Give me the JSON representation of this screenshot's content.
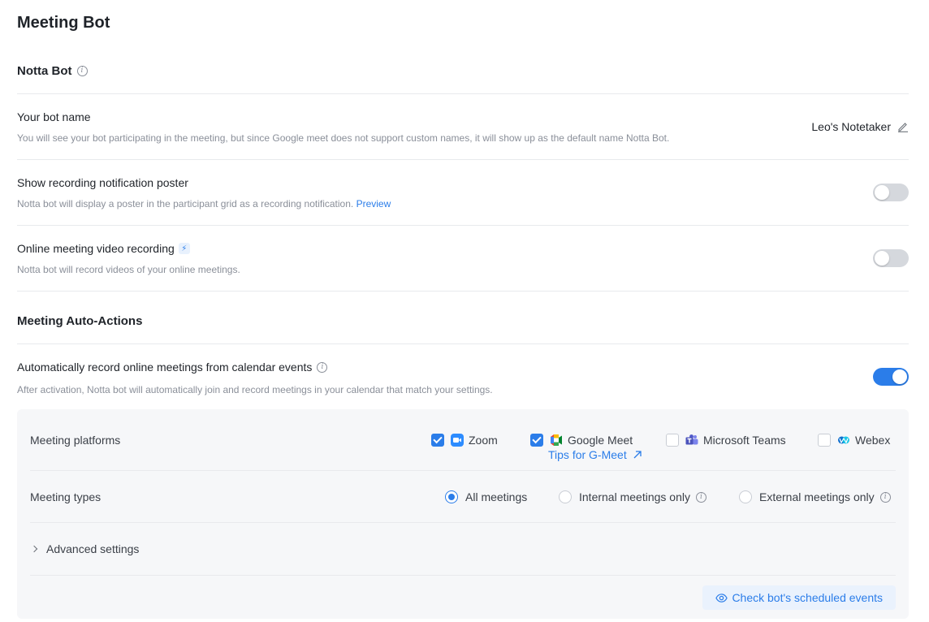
{
  "page_title": "Meeting Bot",
  "notta_bot": {
    "heading": "Notta Bot",
    "bot_name": {
      "title": "Your bot name",
      "desc": "You will see your bot participating in the meeting, but since Google meet does not support custom names, it will show up as the default name Notta Bot.",
      "value": "Leo's Notetaker"
    },
    "poster": {
      "title": "Show recording notification poster",
      "desc": "Notta bot will display a poster in the participant grid as a recording notification.",
      "link": "Preview",
      "enabled": false
    },
    "video": {
      "title": "Online meeting video recording",
      "desc": "Notta bot will record videos of your online meetings.",
      "enabled": false
    }
  },
  "auto_actions": {
    "heading": "Meeting Auto-Actions",
    "auto_record": {
      "title": "Automatically record online meetings from calendar events",
      "desc": "After activation, Notta bot will automatically join and record meetings in your calendar that match your settings.",
      "enabled": true
    },
    "platforms": {
      "label": "Meeting platforms",
      "options": [
        {
          "label": "Zoom",
          "checked": true,
          "icon": "zoom-icon"
        },
        {
          "label": "Google Meet",
          "checked": true,
          "icon": "google-meet-icon"
        },
        {
          "label": "Microsoft Teams",
          "checked": false,
          "icon": "microsoft-teams-icon"
        },
        {
          "label": "Webex",
          "checked": false,
          "icon": "webex-icon"
        }
      ],
      "tips": "Tips for G-Meet"
    },
    "types": {
      "label": "Meeting types",
      "options": [
        {
          "label": "All meetings",
          "checked": true
        },
        {
          "label": "Internal meetings only",
          "checked": false
        },
        {
          "label": "External meetings only",
          "checked": false
        }
      ]
    },
    "advanced": "Advanced settings",
    "check_button": "Check bot's scheduled events"
  },
  "colors": {
    "accent": "#2b7de9",
    "toggle_off": "#d5d8dd",
    "panel_bg": "#f6f7f9"
  }
}
